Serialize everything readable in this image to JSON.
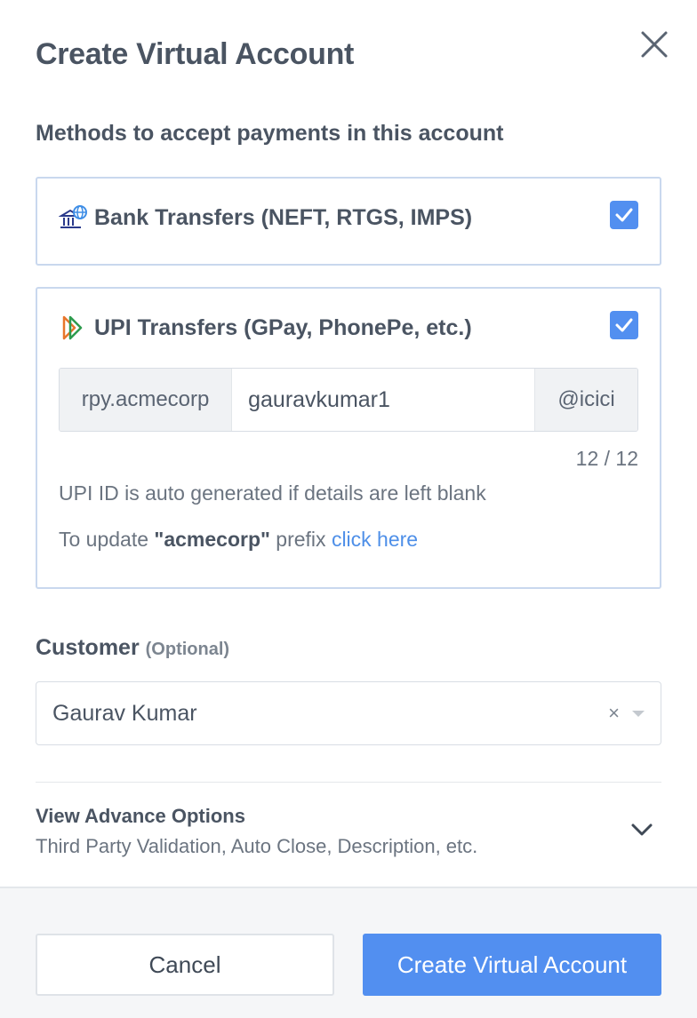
{
  "dialog": {
    "title": "Create Virtual Account"
  },
  "methods": {
    "label": "Methods to accept payments in this account",
    "bank": {
      "label": "Bank Transfers (NEFT, RTGS, IMPS)",
      "checked": true,
      "icon": "bank-globe-icon"
    },
    "upi": {
      "label": "UPI Transfers (GPay, PhonePe, etc.)",
      "checked": true,
      "icon": "upi-logo-icon",
      "prefix": "rpy.acmecorp",
      "value": "gauravkumar1",
      "suffix": "@icici",
      "counter": "12 / 12",
      "hint": "UPI ID is auto generated if details are left blank",
      "update_text_before": "To update ",
      "update_prefix": "\"acmecorp\"",
      "update_text_after": " prefix ",
      "update_link": "click here"
    }
  },
  "customer": {
    "label": "Customer",
    "optional": "(Optional)",
    "value": "Gaurav Kumar",
    "clear": "×"
  },
  "advance": {
    "title": "View Advance Options",
    "subtitle": "Third Party Validation, Auto Close, Description, etc."
  },
  "footer": {
    "cancel_label": "Cancel",
    "create_label": "Create Virtual Account"
  },
  "colors": {
    "accent": "#528ff0",
    "link": "#4e8fe8",
    "card_border": "#c9d8ee"
  }
}
